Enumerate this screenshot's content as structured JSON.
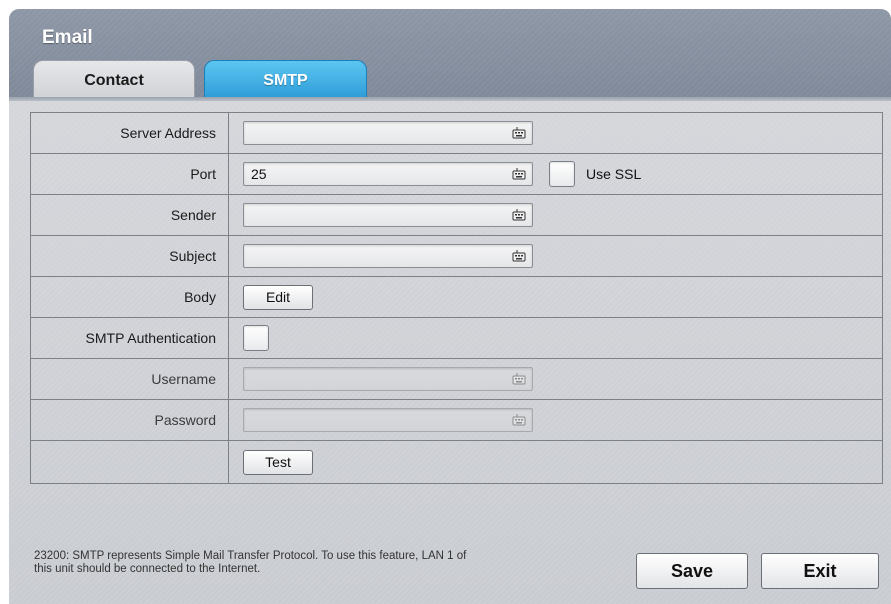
{
  "window": {
    "title": "Email"
  },
  "tabs": [
    {
      "label": "Contact",
      "active": false
    },
    {
      "label": "SMTP",
      "active": true
    }
  ],
  "form": {
    "server_address": {
      "label": "Server Address",
      "value": ""
    },
    "port": {
      "label": "Port",
      "value": "25"
    },
    "use_ssl": {
      "label": "Use SSL",
      "checked": false
    },
    "sender": {
      "label": "Sender",
      "value": ""
    },
    "subject": {
      "label": "Subject",
      "value": ""
    },
    "body": {
      "label": "Body",
      "button_label": "Edit"
    },
    "smtp_auth": {
      "label": "SMTP Authentication",
      "checked": false
    },
    "username": {
      "label": "Username",
      "value": "",
      "disabled": true
    },
    "password": {
      "label": "Password",
      "value": "",
      "disabled": true
    },
    "test_button_label": "Test"
  },
  "footer": {
    "note": "23200: SMTP represents Simple Mail Transfer Protocol. To use this feature, LAN 1 of this unit should be connected to the Internet.",
    "save_label": "Save",
    "exit_label": "Exit"
  },
  "colors": {
    "active_tab": "#2c9ad6",
    "header": "#8d97a6",
    "panel": "#d3d5d9"
  },
  "icons": {
    "input_trailing": "keyboard-icon"
  }
}
